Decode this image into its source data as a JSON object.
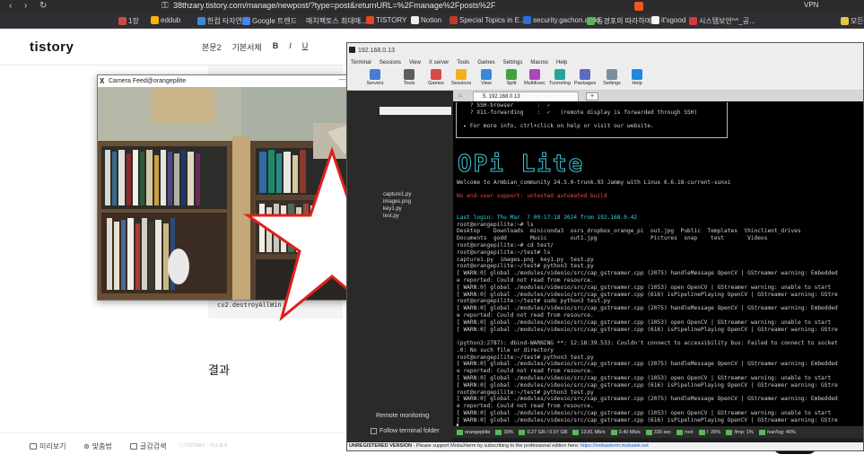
{
  "browser": {
    "url": "38thzary.tistory.com/manage/newpost/?type=post&returnURL=%2Fmanage%2Fposts%2F",
    "vpn_label": "VPN",
    "bookmarks": [
      {
        "label": "1장",
        "color": "#c94a4a"
      },
      {
        "label": "eddub",
        "color": "#f4b400"
      },
      {
        "label": "한컴 타자연습",
        "color": "#3a8bd6"
      },
      {
        "label": "Google 트렌드",
        "color": "#4285f4"
      },
      {
        "label": "매치팩토스 최대매...",
        "color": "#333333"
      },
      {
        "label": "TISTORY",
        "color": "#e8452b"
      },
      {
        "label": "Notion",
        "color": "#eeeeee"
      },
      {
        "label": "Special Topics in E...",
        "color": "#c0392b"
      },
      {
        "label": "security.gachon.ac.kr",
        "color": "#2e6fd1"
      },
      {
        "label": "동경포의 따라하며...",
        "color": "#56b65a"
      },
      {
        "label": "it'sgood",
        "color": "#f5f5f5"
      },
      {
        "label": "시스템보안^^_공...",
        "color": "#d63b3b"
      },
      {
        "label": "모든 북마크",
        "color": "#e8c34a"
      }
    ]
  },
  "tistory": {
    "logo": "tistory",
    "toolbar": [
      "본문2",
      "기본서체",
      "B",
      "I",
      "U"
    ],
    "code_line": "cv2.destroyAllWin",
    "result_heading": "결과",
    "bottom": [
      "미리보기",
      "맞춤법",
      "글감검색"
    ],
    "footer_note": "ⓒTISTORY · 티스토리"
  },
  "camera": {
    "title": "Camera Feed@orangepilite",
    "controls": [
      "—",
      "□",
      "✕"
    ]
  },
  "moba": {
    "title": "192.168.0.13",
    "menu": [
      "Terminal",
      "Sessions",
      "View",
      "X server",
      "Tools",
      "Games",
      "Settings",
      "Macros",
      "Help"
    ],
    "tools": [
      {
        "label": "Servers",
        "color": "#4a7bd1"
      },
      {
        "label": "Tools",
        "color": "#5d5d5d"
      },
      {
        "label": "Games",
        "color": "#d84a4a"
      },
      {
        "label": "Sessions",
        "color": "#f0b21a"
      },
      {
        "label": "View",
        "color": "#3a88d9"
      },
      {
        "label": "Split",
        "color": "#43a047"
      },
      {
        "label": "MultiExec",
        "color": "#ab47bc"
      },
      {
        "label": "Tunneling",
        "color": "#26a69a"
      },
      {
        "label": "Packages",
        "color": "#5c6bc0"
      },
      {
        "label": "Settings",
        "color": "#78909c"
      },
      {
        "label": "Help",
        "color": "#1e88e5"
      }
    ],
    "sidebar_files": [
      "capture1.py",
      "images.png",
      "key1.py",
      "test.py"
    ],
    "remote_monitoring": "Remote monitoring",
    "follow_folder": "Follow terminal folder",
    "tab_label": "5. 192.168.0.13",
    "banner": "OPi Lite",
    "terminal_lines": [
      {
        "t": "    ? SSH-browser       :  ✓",
        "c": ""
      },
      {
        "t": "    ? X11-forwarding    :  ✓   (remote display is forwarded through SSH)",
        "c": ""
      },
      {
        "t": "",
        "c": ""
      },
      {
        "t": "  ▸ For more info, ctrl+click on help or visit our website.",
        "c": ""
      },
      {
        "t": "",
        "c": ""
      },
      {
        "t": "",
        "c": ""
      },
      {
        "t": "",
        "c": ""
      },
      {
        "t": "",
        "c": ""
      },
      {
        "t": "",
        "c": ""
      },
      {
        "t": "",
        "c": ""
      },
      {
        "t": "",
        "c": ""
      },
      {
        "t": "Welcome to Armbian_community 24.5.0-trunk.93 Jammy with Linux 6.6.18-current-sunxi",
        "c": ""
      },
      {
        "t": "",
        "c": ""
      },
      {
        "t": "No end-user support: untested automated build",
        "c": "c-red"
      },
      {
        "t": "",
        "c": ""
      },
      {
        "t": "",
        "c": ""
      },
      {
        "t": "Last login: Thu Mar  7 00:17:18 2024 from 192.168.0.42",
        "c": "c-cyan"
      },
      {
        "t": "root@orangepilite:~# ls",
        "c": ""
      },
      {
        "t": "Desktop    Downloads  miniconda3  osrs_dropbox_orange_pi  out.jpg  Public  Templates  thinclient_drives",
        "c": ""
      },
      {
        "t": "Documents  godd       Music       out1.jpg                Pictures  snap    test       Videos",
        "c": ""
      },
      {
        "t": "root@orangepilite:~# cd test/",
        "c": ""
      },
      {
        "t": "root@orangepilite:~/test# ls",
        "c": ""
      },
      {
        "t": "capture1.py  images.png  key1.py  test.py",
        "c": ""
      },
      {
        "t": "root@orangepilite:~/test# python3 test.py",
        "c": ""
      },
      {
        "t": "[ WARN:0] global ./modules/videoio/src/cap_gstreamer.cpp (2075) handleMessage OpenCV | GStreamer warning: Embedded",
        "c": ""
      },
      {
        "t": "e reported: Could not read from resource.",
        "c": ""
      },
      {
        "t": "[ WARN:0] global ./modules/videoio/src/cap_gstreamer.cpp (1053) open OpenCV | GStreamer warning: unable to start",
        "c": ""
      },
      {
        "t": "[ WARN:0] global ./modules/videoio/src/cap_gstreamer.cpp (616) isPipelinePlaying OpenCV | GStreamer warning: GStre",
        "c": ""
      },
      {
        "t": "root@orangepilite:~/test# sudo python3 test.py",
        "c": ""
      },
      {
        "t": "[ WARN:0] global ./modules/videoio/src/cap_gstreamer.cpp (2075) handleMessage OpenCV | GStreamer warning: Embedded",
        "c": ""
      },
      {
        "t": "e reported: Could not read from resource.",
        "c": ""
      },
      {
        "t": "[ WARN:0] global ./modules/videoio/src/cap_gstreamer.cpp (1053) open OpenCV | GStreamer warning: unable to start",
        "c": ""
      },
      {
        "t": "[ WARN:0] global ./modules/videoio/src/cap_gstreamer.cpp (616) isPipelinePlaying OpenCV | GStreamer warning: GStre",
        "c": ""
      },
      {
        "t": "",
        "c": ""
      },
      {
        "t": "(python3:2787): dbind-WARNING **: 12:18:39.533: Couldn't connect to accessibility bus: Failed to connect to socket",
        "c": ""
      },
      {
        "t": ".0: No such file or directory",
        "c": ""
      },
      {
        "t": "root@orangepilite:~/test# python3 test.py",
        "c": ""
      },
      {
        "t": "[ WARN:0] global ./modules/videoio/src/cap_gstreamer.cpp (2075) handleMessage OpenCV | GStreamer warning: Embedded",
        "c": ""
      },
      {
        "t": "e reported: Could not read from resource.",
        "c": ""
      },
      {
        "t": "[ WARN:0] global ./modules/videoio/src/cap_gstreamer.cpp (1053) open OpenCV | GStreamer warning: unable to start",
        "c": ""
      },
      {
        "t": "[ WARN:0] global ./modules/videoio/src/cap_gstreamer.cpp (616) isPipelinePlaying OpenCV | GStreamer warning: GStre",
        "c": ""
      },
      {
        "t": "root@orangepilite:~/test# python3 test.py",
        "c": ""
      },
      {
        "t": "[ WARN:0] global ./modules/videoio/src/cap_gstreamer.cpp (2075) handleMessage OpenCV | GStreamer warning: Embedded",
        "c": ""
      },
      {
        "t": "e reported: Could not read from resource.",
        "c": ""
      },
      {
        "t": "[ WARN:0] global ./modules/videoio/src/cap_gstreamer.cpp (1053) open OpenCV | GStreamer warning: unable to start",
        "c": ""
      },
      {
        "t": "[ WARN:0] global ./modules/videoio/src/cap_gstreamer.cpp (616) isPipelinePlaying OpenCV | GStreamer warning: GStre",
        "c": ""
      },
      {
        "t": "▌",
        "c": ""
      }
    ],
    "status": [
      {
        "label": "orangepilite"
      },
      {
        "label": "30%"
      },
      {
        "label": "0.27 GB / 0.97 GB"
      },
      {
        "label": "13.81 Mb/s"
      },
      {
        "label": "0.40 Mb/s"
      },
      {
        "label": "330 sec"
      },
      {
        "label": "root"
      },
      {
        "label": "/: 26%"
      },
      {
        "label": "/tmp: 1%"
      },
      {
        "label": "/var/log: 46%"
      }
    ],
    "unregistered": "UNREGISTERED VERSION",
    "unregistered_msg": " - Please support MobaXterm by subscribing to the professional edition here: ",
    "unregistered_link": "https://mobaxterm.mobatek.net"
  }
}
